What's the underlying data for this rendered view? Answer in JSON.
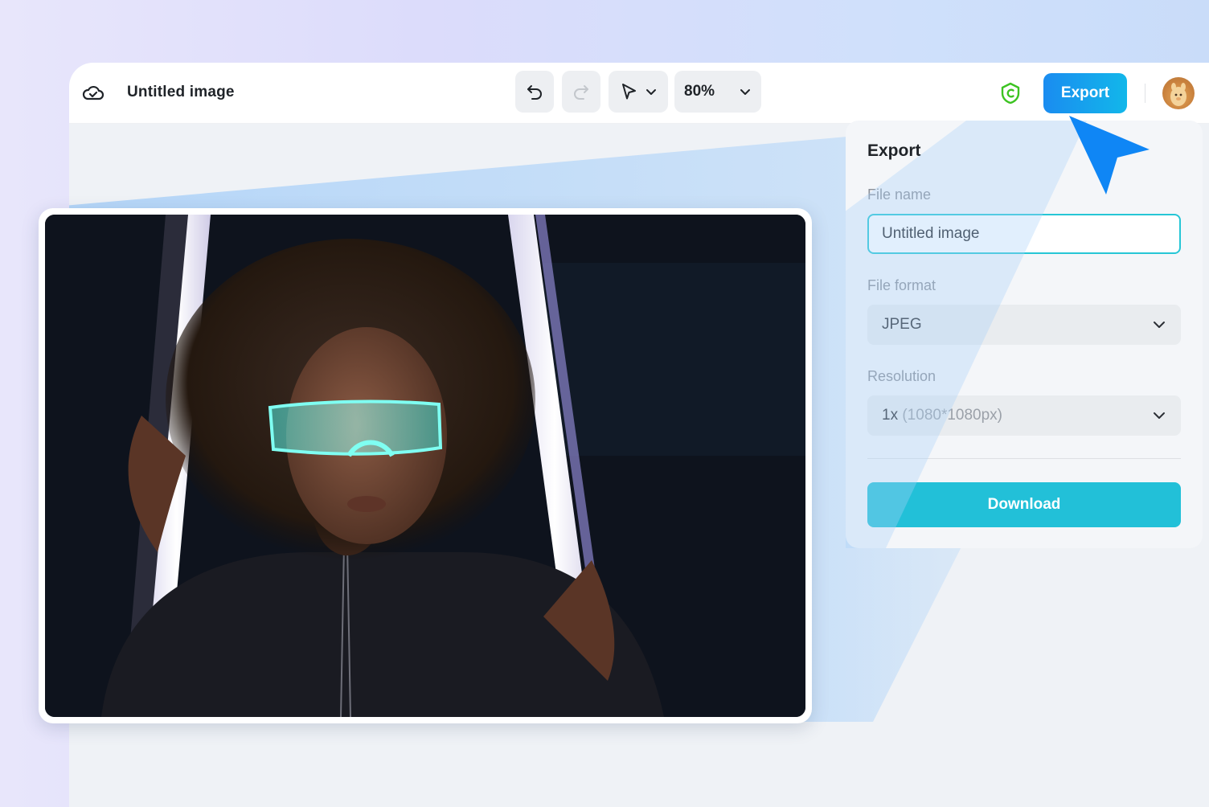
{
  "header": {
    "title": "Untitled image",
    "zoom": "80%",
    "export_label": "Export"
  },
  "icons": {
    "cloud": "cloud-check-icon",
    "undo": "undo-icon",
    "redo": "redo-icon",
    "select": "pointer-icon",
    "chevron": "chevron-down-icon",
    "copyright": "copyright-shield-icon",
    "cursor": "cursor-arrow-icon"
  },
  "export_panel": {
    "title": "Export",
    "file_name_label": "File name",
    "file_name_value": "Untitled image",
    "file_format_label": "File format",
    "file_format_value": "JPEG",
    "resolution_label": "Resolution",
    "resolution_scale": "1x",
    "resolution_detail": "(1080*1080px)",
    "download_label": "Download"
  },
  "colors": {
    "accent_gradient_start": "#1a8cf0",
    "accent_gradient_end": "#12b7ea",
    "download": "#22c0d8",
    "input_border": "#26c6d6",
    "shield": "#3cc321",
    "cursor": "#0f86f5"
  }
}
